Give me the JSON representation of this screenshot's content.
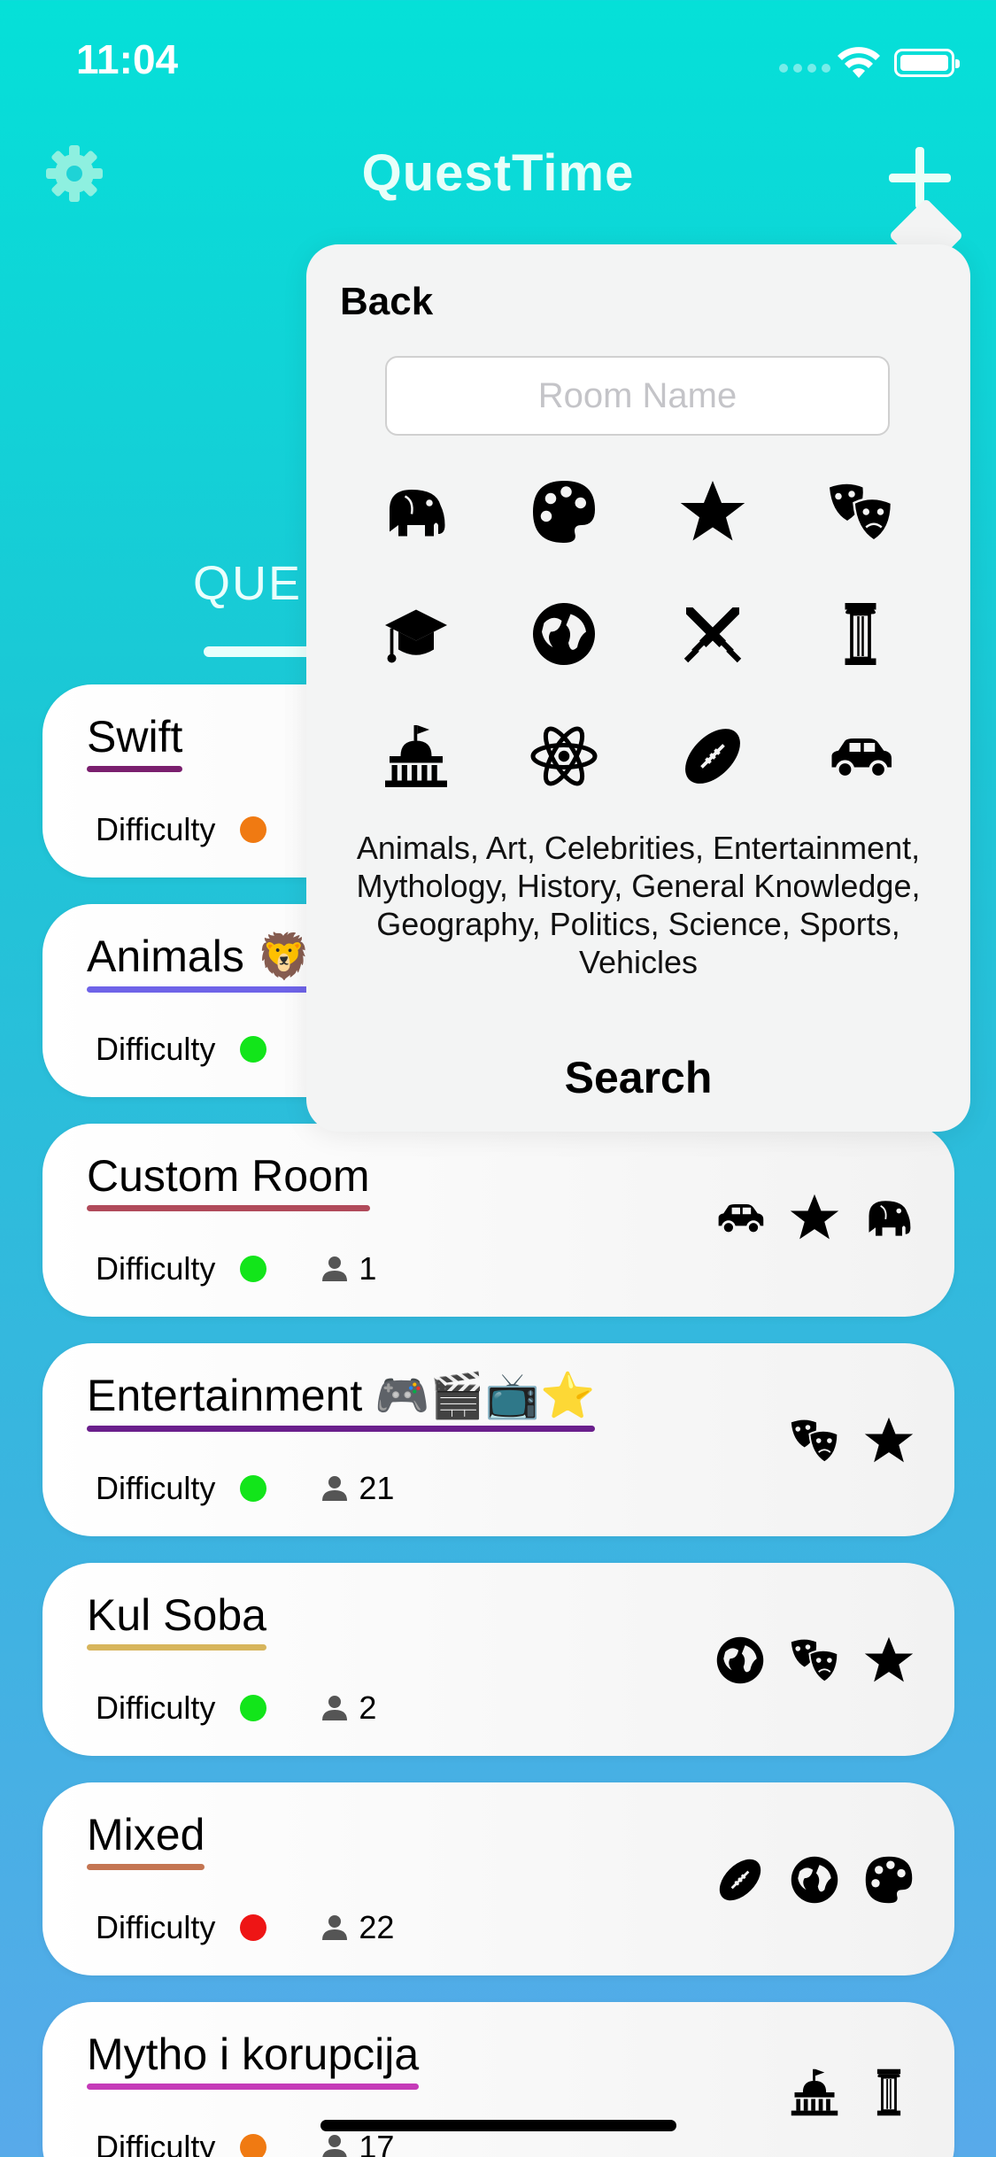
{
  "status": {
    "time": "11:04"
  },
  "nav": {
    "title": "QuestTime"
  },
  "background_tab": {
    "label": "QUE"
  },
  "rooms": [
    {
      "name": "Swift",
      "underline": "#7a1f6e",
      "difficulty_label": "Difficulty",
      "difficulty_color": "#f07a12",
      "players": "",
      "icons": []
    },
    {
      "name": "Animals 🦁",
      "underline": "#6e63e8",
      "difficulty_label": "Difficulty",
      "difficulty_color": "#12e51a",
      "players": "",
      "icons": []
    },
    {
      "name": "Custom Room",
      "underline": "#b04a5a",
      "difficulty_label": "Difficulty",
      "difficulty_color": "#12e51a",
      "players": "1",
      "icons": [
        "car-icon",
        "star-icon",
        "elephant-icon"
      ]
    },
    {
      "name": "Entertainment 🎮🎬📺⭐",
      "underline": "#6a1f8c",
      "difficulty_label": "Difficulty",
      "difficulty_color": "#12e51a",
      "players": "21",
      "icons": [
        "masks-icon",
        "star-icon"
      ]
    },
    {
      "name": "Kul Soba",
      "underline": "#d7b55c",
      "difficulty_label": "Difficulty",
      "difficulty_color": "#12e51a",
      "players": "2",
      "icons": [
        "globe-icon",
        "masks-icon",
        "star-icon"
      ]
    },
    {
      "name": "Mixed",
      "underline": "#c47552",
      "difficulty_label": "Difficulty",
      "difficulty_color": "#ee1515",
      "players": "22",
      "icons": [
        "football-icon",
        "globe-icon",
        "palette-icon"
      ]
    },
    {
      "name": "Mytho i korupcija",
      "underline": "#c53ab8",
      "difficulty_label": "Difficulty",
      "difficulty_color": "#f07a12",
      "players": "17",
      "icons": [
        "capitol-icon",
        "column-icon"
      ]
    }
  ],
  "popover": {
    "back_label": "Back",
    "room_name_placeholder": "Room Name",
    "category_icons": [
      "elephant-icon",
      "palette-icon",
      "star-icon",
      "masks-icon",
      "graduation-cap-icon",
      "globe-icon",
      "swords-icon",
      "column-icon",
      "capitol-icon",
      "atom-icon",
      "football-icon",
      "car-icon"
    ],
    "categories_text": "Animals, Art, Celebrities, Entertainment, Mythology, History, General Knowledge, Geography, Politics, Science, Sports, Vehicles",
    "search_label": "Search"
  },
  "colors": {
    "background_top": "#05e0d8",
    "background_bottom": "#58aaea",
    "popover_bg": "#f3f4f4"
  }
}
